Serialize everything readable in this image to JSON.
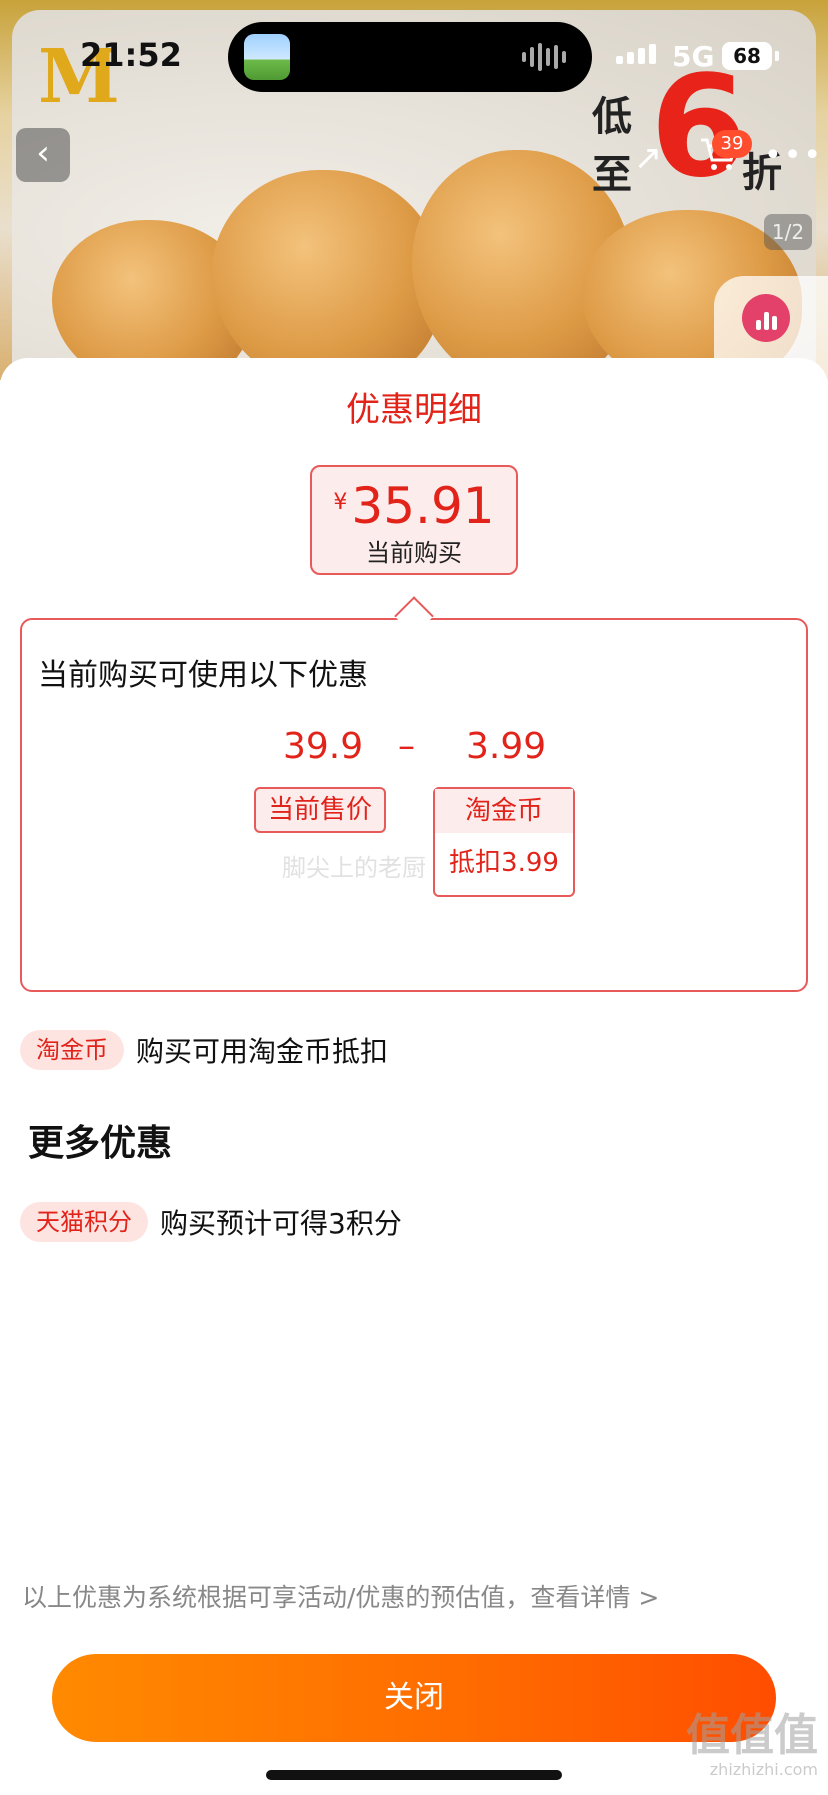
{
  "status_bar": {
    "time": "21:52",
    "network": "5G",
    "battery": "68"
  },
  "product_page": {
    "promo_low": "低至",
    "promo_digit": "6",
    "promo_zhe": "折",
    "cart_count": "39",
    "image_index": "1/2",
    "icons": {
      "back": "chevron-left-icon",
      "share": "share-icon",
      "cart": "cart-icon",
      "more": "more-dots-icon",
      "chart": "bar-chart-icon"
    }
  },
  "sheet": {
    "title": "优惠明细",
    "price": {
      "currency": "¥",
      "value": "35.91",
      "label": "当前购买"
    },
    "detail": {
      "intro": "当前购买可使用以下优惠",
      "original_price": "39.9",
      "operator": "–",
      "discount": "3.99",
      "original_label": "当前售价",
      "discount_label": "淘金币",
      "discount_note": "抵扣3.99",
      "watermark": "脚尖上的老厨"
    },
    "benefits": [
      {
        "tag": "淘金币",
        "text": "购买可用淘金币抵扣"
      }
    ],
    "more_title": "更多优惠",
    "more_benefits": [
      {
        "tag": "天猫积分",
        "text": "购买预计可得3积分"
      }
    ],
    "footnote": "以上优惠为系统根据可享活动/优惠的预估值，查看详情 >",
    "close_label": "关闭"
  },
  "site_mark": {
    "big": "值值值",
    "small": "zhizhizhi.com"
  },
  "colors": {
    "accent_red": "#e2231a",
    "button_orange": "#ff6a00"
  }
}
